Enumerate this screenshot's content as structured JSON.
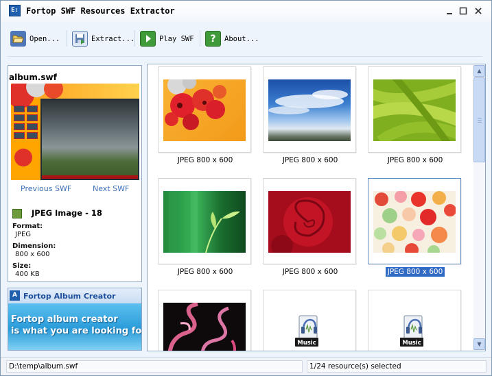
{
  "window": {
    "title": "Fortop SWF Resources Extractor",
    "app_icon": "E:"
  },
  "toolbar": {
    "buttons": [
      {
        "label": "Open...",
        "icon": "folder-open-icon",
        "color": "#4d77b8"
      },
      {
        "label": "Extract...",
        "icon": "save-disk-icon",
        "color": "#5d7fb0"
      },
      {
        "label": "Play SWF",
        "icon": "play-icon",
        "color": "#3f9b3a"
      },
      {
        "label": "About...",
        "icon": "help-icon",
        "color": "#3f9b3a"
      }
    ]
  },
  "left_panel": {
    "swf_name": "album.swf",
    "previous_label": "Previous SWF",
    "next_label": "Next SWF",
    "resource_title": "JPEG Image - 18",
    "format_label": "Format:",
    "format_value": "JPEG",
    "dimension_label": "Dimension:",
    "dimension_value": "800 x 600",
    "size_label": "Size:",
    "size_value": "400 KB"
  },
  "ad": {
    "logo": "A",
    "title": "Fortop Album Creator",
    "line1": "Fortop album creator",
    "line2": "is what you are looking for!"
  },
  "grid": {
    "items": [
      {
        "caption": "JPEG 800 x 600",
        "type": "image",
        "scene": "red-bubbles",
        "selected": false
      },
      {
        "caption": "JPEG 800 x 600",
        "type": "image",
        "scene": "blue-sky",
        "selected": false
      },
      {
        "caption": "JPEG 800 x 600",
        "type": "image",
        "scene": "green-beans",
        "selected": false
      },
      {
        "caption": "JPEG 800 x 600",
        "type": "image",
        "scene": "bamboo-sprout",
        "selected": false
      },
      {
        "caption": "JPEG 800 x 600",
        "type": "image",
        "scene": "red-rose",
        "selected": false
      },
      {
        "caption": "JPEG 800 x 600",
        "type": "image",
        "scene": "colorful-dots",
        "selected": true
      },
      {
        "caption": "",
        "type": "image",
        "scene": "pink-smoke",
        "selected": false
      },
      {
        "caption": "",
        "type": "music",
        "music_label": "Music",
        "selected": false
      },
      {
        "caption": "",
        "type": "music",
        "music_label": "Music",
        "selected": false
      }
    ]
  },
  "status": {
    "path": "D:\\temp\\album.swf",
    "selection": "1/24 resource(s) selected"
  },
  "colors": {
    "accent": "#316ac5",
    "link": "#3d6fb5",
    "panel_border": "#8fa7c4"
  }
}
